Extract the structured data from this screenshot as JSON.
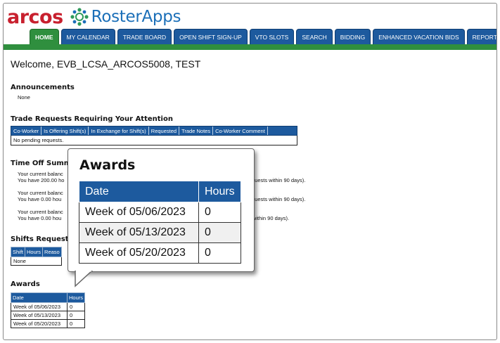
{
  "brand": {
    "left": "arcos",
    "right": "RosterApps"
  },
  "nav": {
    "tabs": [
      "HOME",
      "MY CALENDAR",
      "TRADE BOARD",
      "OPEN SHIFT SIGN-UP",
      "VTO SLOTS",
      "SEARCH",
      "BIDDING",
      "ENHANCED VACATION BIDS",
      "REPORTS"
    ],
    "active": "HOME"
  },
  "welcome": "Welcome, EVB_LCSA_ARCOS5008, TEST",
  "announcements": {
    "title": "Announcements",
    "text": "None"
  },
  "trade_requests": {
    "title": "Trade Requests Requiring Your Attention",
    "columns": [
      "Co-Worker",
      "Is Offering Shift(s)",
      "In Exchange for Shift(s)",
      "Requested",
      "Trade Notes",
      "Co-Worker Comment"
    ],
    "empty": "No pending requests."
  },
  "time_off": {
    "title": "Time Off Summ",
    "lines": [
      {
        "a": "Your current balanc",
        "b": "You have 200.00 ho",
        "suffix": "quests within 90 days)."
      },
      {
        "a": "Your current balanc",
        "b": "You have 0.00 hou",
        "suffix": "quests within 90 days)."
      },
      {
        "a": "Your current balanc",
        "b": "You have 0.00 hou",
        "suffix": "ts within 90 days)."
      }
    ]
  },
  "shifts_requested": {
    "title": "Shifts Request",
    "columns": [
      "Shift",
      "Hours",
      "Reaso"
    ],
    "empty": "None"
  },
  "awards": {
    "title": "Awards",
    "columns": [
      "Date",
      "Hours"
    ],
    "rows": [
      [
        "Week of 05/06/2023",
        "0"
      ],
      [
        "Week of 05/13/2023",
        "0"
      ],
      [
        "Week of 05/20/2023",
        "0"
      ]
    ]
  },
  "colors": {
    "nav_blue": "#1d5a9e",
    "active_green": "#2f8f3e",
    "arcos_red": "#c8202e",
    "roster_blue": "#1b6fb8"
  }
}
